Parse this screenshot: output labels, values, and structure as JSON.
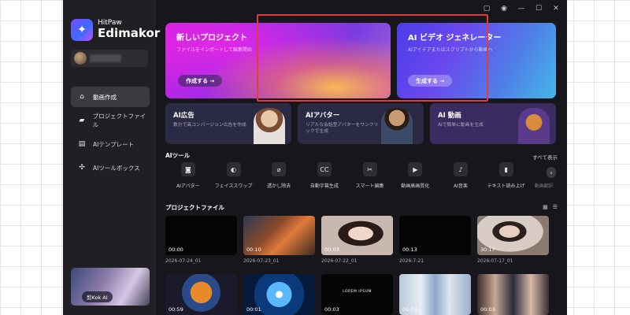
{
  "sidebar": {
    "brand_small": "HitPaw",
    "brand_big": "Edimakor",
    "nav": [
      {
        "label": "動画作成",
        "icon": "home-icon",
        "active": true
      },
      {
        "label": "プロジェクトファイル",
        "icon": "folder-icon",
        "active": false
      },
      {
        "label": "AIテンプレート",
        "icon": "template-icon",
        "active": false
      },
      {
        "label": "AIツールボックス",
        "icon": "toolbox-icon",
        "active": false
      }
    ],
    "promo_label": "剪Kok AI"
  },
  "titlebar": {
    "icons": [
      "feedback-icon",
      "info-icon",
      "minimize-icon",
      "maximize-icon",
      "close-icon"
    ]
  },
  "hero": {
    "new_project": {
      "title": "新しいプロジェクト",
      "subtitle": "ファイルをインポートして編集開始",
      "button": "作成する →"
    },
    "ai_video": {
      "title": "AI ビデオ ジェネレーター",
      "subtitle": "AIアイデアまたはスクリプトから動画へ",
      "button": "生成する →"
    }
  },
  "features": [
    {
      "title": "AI広告",
      "subtitle": "数分で高コンバージョン広告を作成"
    },
    {
      "title": "AIアバター",
      "subtitle": "リアルな会話型アバターをワンクリックで生成"
    },
    {
      "title": "AI 動画",
      "subtitle": "AIで簡単に動画を生成"
    }
  ],
  "ai_tools": {
    "title": "AIツール",
    "see_all": "すべて表示",
    "items": [
      {
        "label": "AIアバター",
        "icon": "avatar-icon"
      },
      {
        "label": "フェイススワップ",
        "icon": "face-swap-icon"
      },
      {
        "label": "透かし除去",
        "icon": "watermark-remove-icon"
      },
      {
        "label": "自動字幕生成",
        "icon": "subtitle-icon"
      },
      {
        "label": "スマート編集",
        "icon": "smart-edit-icon"
      },
      {
        "label": "動画高画質化",
        "icon": "video-enhance-icon"
      },
      {
        "label": "AI音楽",
        "icon": "music-icon"
      },
      {
        "label": "テキスト読み上げ",
        "icon": "text-to-speech-icon"
      },
      {
        "label": "動画翻訳",
        "icon": "translate-icon"
      }
    ]
  },
  "project_files": {
    "title": "プロジェクトファイル",
    "row1": [
      {
        "duration": "00:00",
        "date": "2026-07-24_01"
      },
      {
        "duration": "00:10",
        "date": "2026-07-23_01"
      },
      {
        "duration": "00:03",
        "date": "2026-07-22_01"
      },
      {
        "duration": "00:13",
        "date": "2026-7-21"
      },
      {
        "duration": "30:17",
        "date": "2026-07-17_01"
      }
    ],
    "row2": [
      {
        "duration": "00:59",
        "date": ""
      },
      {
        "duration": "00:01",
        "date": ""
      },
      {
        "duration": "00:03",
        "date": "",
        "overlay": "LOREM IPSUM"
      },
      {
        "duration": "00:03",
        "date": ""
      },
      {
        "duration": "00:03",
        "date": ""
      }
    ]
  }
}
